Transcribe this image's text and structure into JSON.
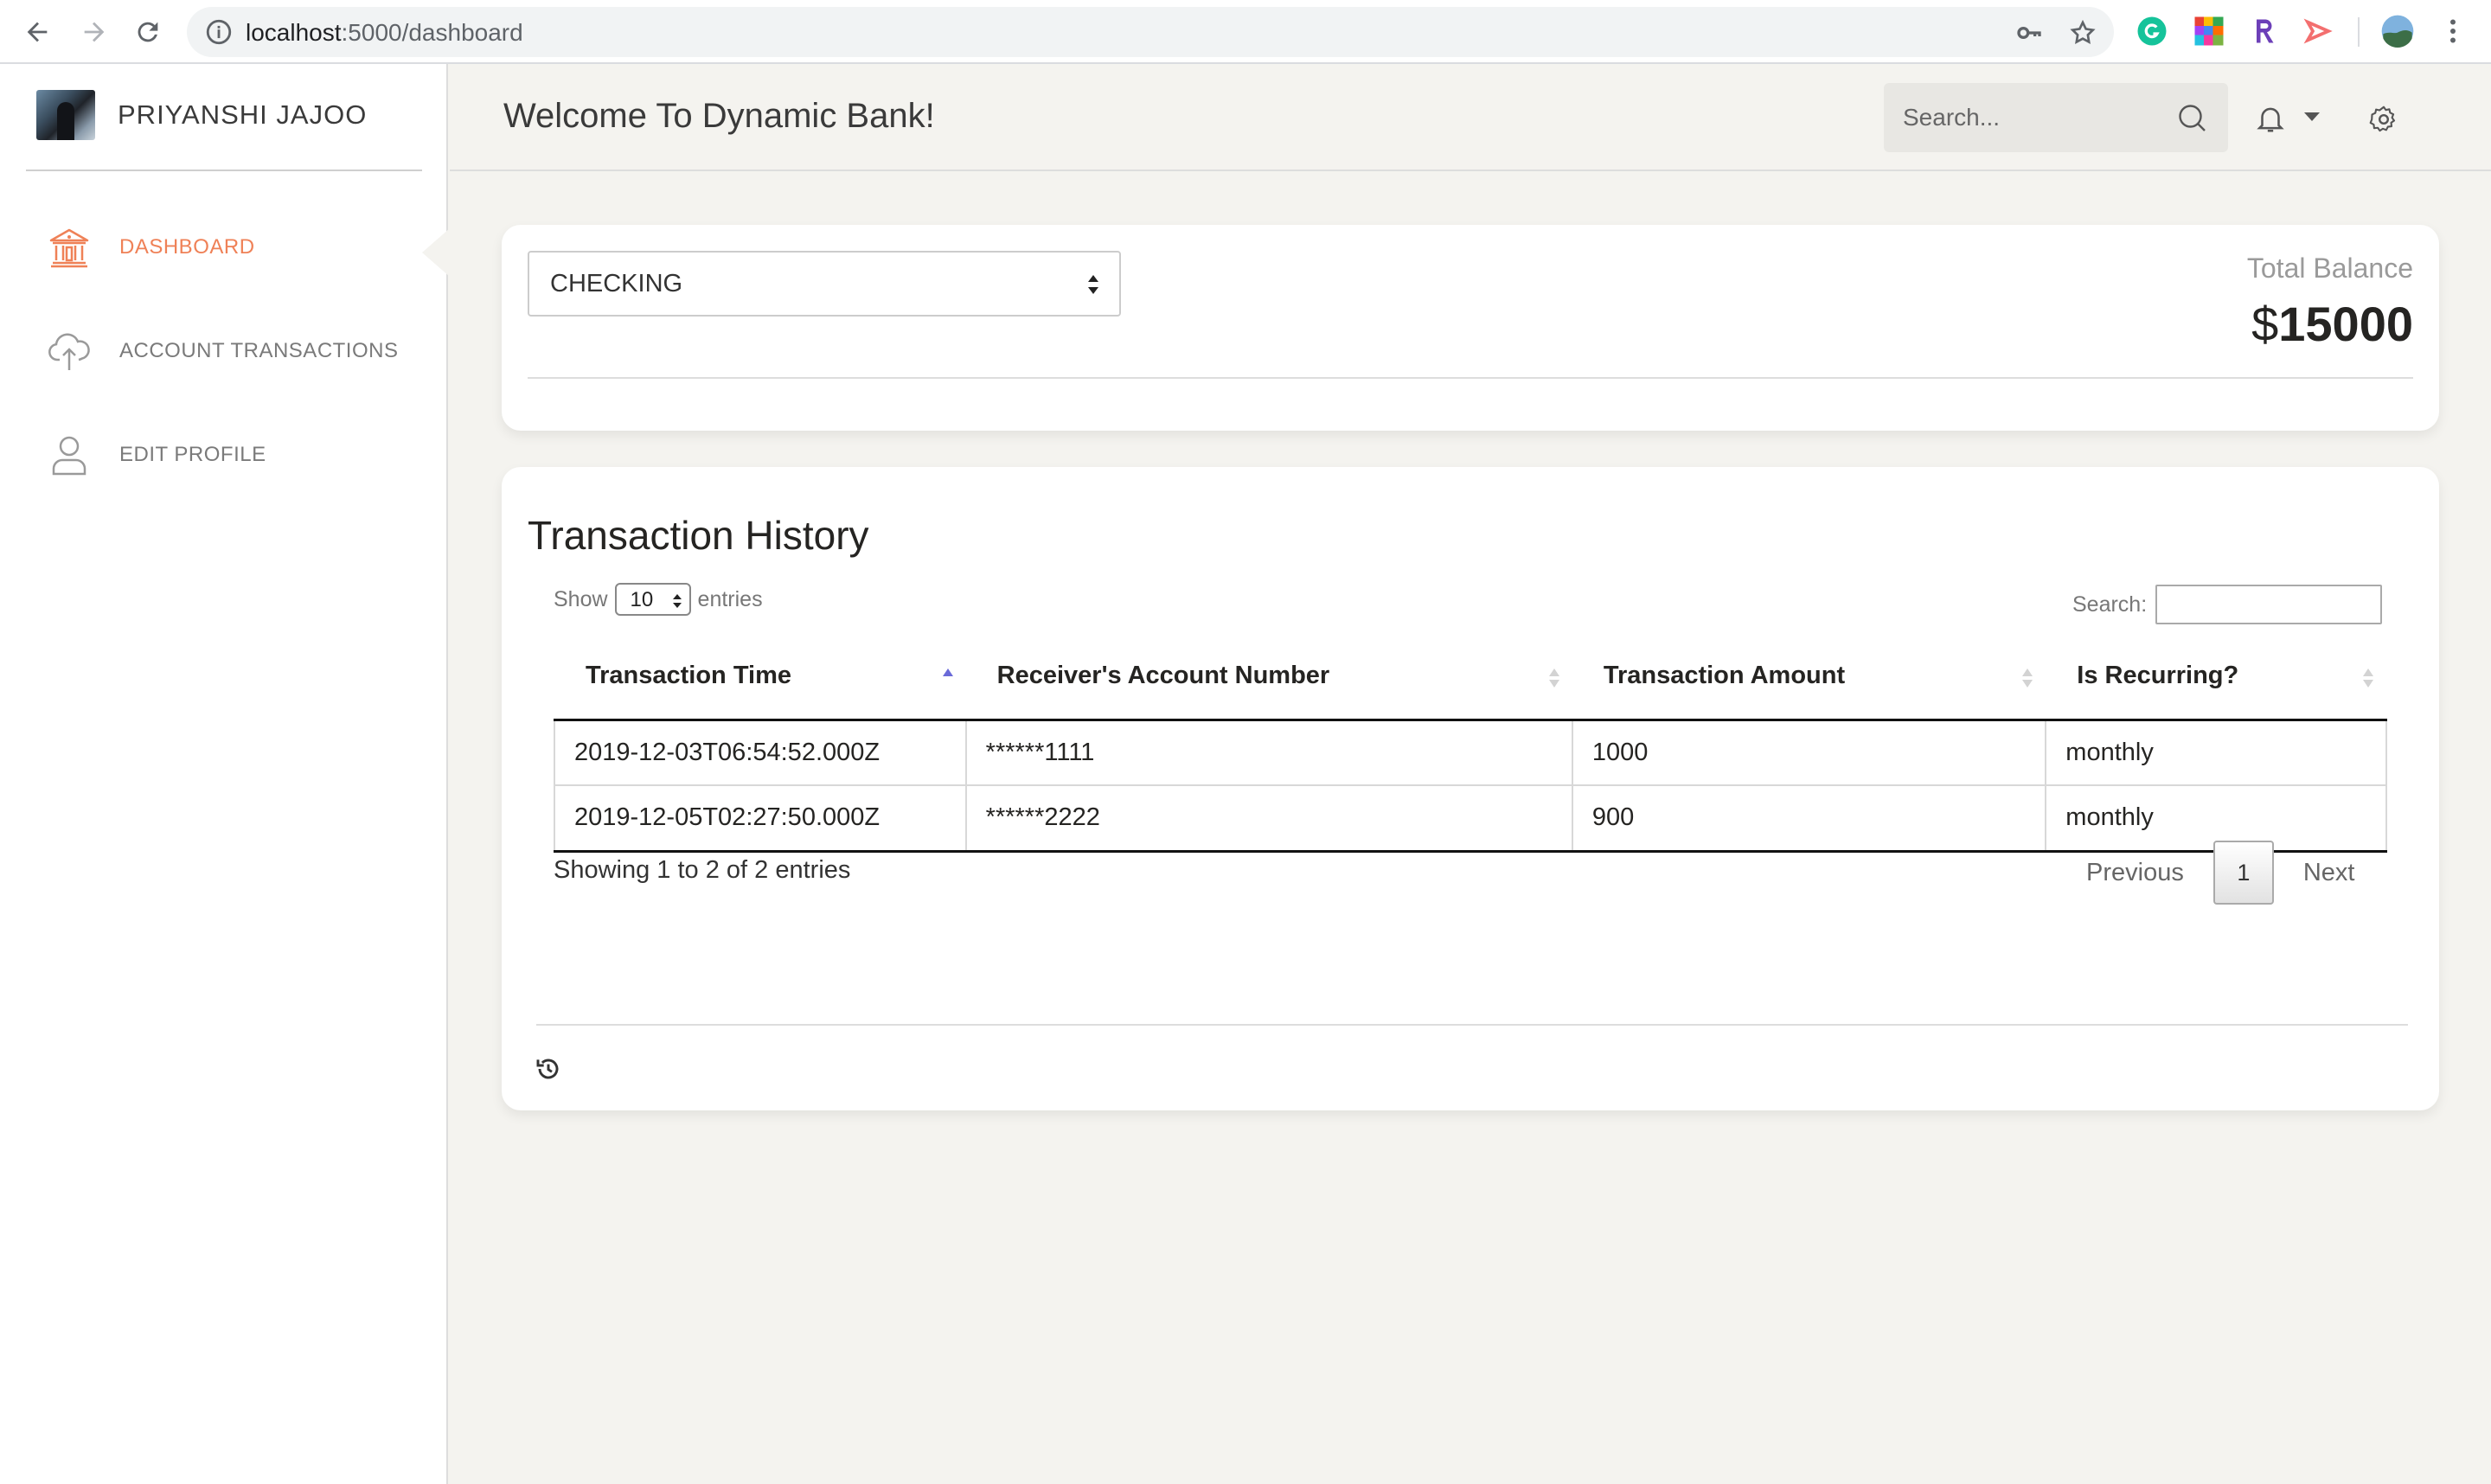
{
  "browser": {
    "url_host": "localhost",
    "url_path": ":5000/dashboard"
  },
  "sidebar": {
    "user_name": "PRIYANSHI JAJOO",
    "items": [
      {
        "label": "DASHBOARD",
        "icon": "bank-icon",
        "active": true
      },
      {
        "label": "ACCOUNT TRANSACTIONS",
        "icon": "cloud-upload-icon",
        "active": false
      },
      {
        "label": "EDIT PROFILE",
        "icon": "user-icon",
        "active": false
      }
    ]
  },
  "header": {
    "title": "Welcome To Dynamic Bank!",
    "search_placeholder": "Search..."
  },
  "balance": {
    "account_type": "CHECKING",
    "label": "Total Balance",
    "currency": "$",
    "amount": "15000"
  },
  "transactions": {
    "title": "Transaction History",
    "show_prefix": "Show",
    "page_length": "10",
    "show_suffix": "entries",
    "search_label": "Search:",
    "columns": [
      "Transaction Time",
      "Receiver's Account Number",
      "Transaction Amount",
      "Is Recurring?"
    ],
    "rows": [
      [
        "2019-12-03T06:54:52.000Z",
        "******1111",
        "1000",
        "monthly"
      ],
      [
        "2019-12-05T02:27:50.000Z",
        "******2222",
        "900",
        "monthly"
      ]
    ],
    "info": "Showing 1 to 2 of 2 entries",
    "previous": "Previous",
    "current_page": "1",
    "next": "Next"
  },
  "colors": {
    "accent": "#ef8157",
    "background": "#f4f3ef",
    "sort_active": "#6a6ad8"
  }
}
